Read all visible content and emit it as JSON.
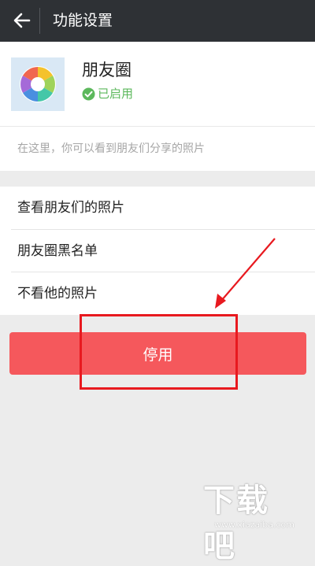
{
  "header": {
    "title": "功能设置"
  },
  "app": {
    "name": "朋友圈",
    "status": "已启用",
    "status_color": "#5cb85c"
  },
  "description": "在这里，你可以看到朋友们分享的照片",
  "menu": {
    "items": [
      {
        "label": "查看朋友们的照片"
      },
      {
        "label": "朋友圈黑名单"
      },
      {
        "label": "不看他的照片"
      }
    ]
  },
  "actions": {
    "disable_label": "停用",
    "disable_color": "#f5585c"
  },
  "annotation": {
    "color": "#e8191f"
  },
  "watermark": {
    "logo": "下载吧",
    "url": "www.xiazaiba.com"
  }
}
